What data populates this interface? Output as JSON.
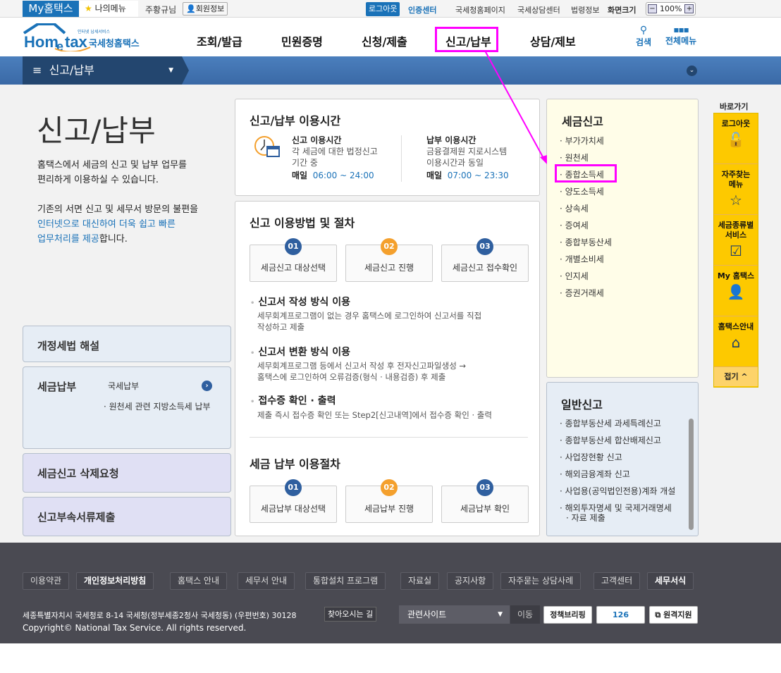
{
  "topbar": {
    "my_hometax": "My홈택스",
    "my_menu": "나의메뉴",
    "user_name": "주황규님",
    "member_info": "회원정보",
    "logout": "로그아웃",
    "cert_center": "인증센터",
    "links": [
      "국세청홈페이지",
      "국세상담센터",
      "법령정보"
    ],
    "screen_size_label": "화면크기",
    "zoom_level": "100%",
    "zoom_out": "−",
    "zoom_in": "+"
  },
  "header": {
    "logo_main": "Hometax",
    "logo_tagline": "인터넷 납세서비스",
    "logo_sub": "국세청홈택스",
    "nav": [
      "조회/발급",
      "민원증명",
      "신청/제출",
      "신고/납부",
      "상담/제보"
    ],
    "search": "검색",
    "all_menu": "전체메뉴"
  },
  "subnav": {
    "current": "신고/납부"
  },
  "left": {
    "title": "신고/납부",
    "desc1a": "홈택스에서 세금의 신고 및 납부 업무를",
    "desc1b": "편리하게 이용하실 수 있습니다.",
    "desc2a": "기존의 서면 신고 및 세무서 방문의 불편을",
    "desc2b": "인터넷으로 대신하여 더욱 쉽고 빠른",
    "desc2c": "업무처리를 제공",
    "desc2d": "합니다.",
    "boxes": {
      "b1": "개정세법 해설",
      "b2": "세금납부",
      "b2_items": [
        "국세납부",
        "원천세 관련 지방소득세 납부"
      ],
      "b3": "세금신고 삭제요청",
      "b4": "신고부속서류제출"
    }
  },
  "hours": {
    "title": "신고/납부 이용시간",
    "report": {
      "label": "신고 이용시간",
      "desc1": "각 세금에 대한 법정신고",
      "desc2": "기간 중",
      "daily": "매일",
      "time": "06:00 ~ 24:00"
    },
    "pay": {
      "label": "납부 이용시간",
      "desc1": "금융결제원 지로시스템",
      "desc2": "이용시간과 동일",
      "daily": "매일",
      "time": "07:00 ~ 23:30"
    }
  },
  "procedure": {
    "title": "신고 이용방법 및 절차",
    "steps": [
      {
        "num": "01",
        "label": "세금신고 대상선택"
      },
      {
        "num": "02",
        "label": "세금신고 진행"
      },
      {
        "num": "03",
        "label": "세금신고 접수확인"
      }
    ],
    "methods": [
      {
        "title": "신고서 작성 방식 이용",
        "l1": "세무회계프로그램이 없는 경우 홈택스에 로그인하여 신고서를 직접",
        "l2": "작성하고 제출"
      },
      {
        "title": "신고서 변환 방식 이용",
        "l1": "세무회계프로그램 등에서 신고서 작성 후 전자신고파일생성 →",
        "l2": "홈택스에 로그인하여 오류검증(형식 · 내용검증) 후 제출"
      },
      {
        "title": "접수증 확인 · 출력",
        "l1": "제출 즉시 접수증 확인 또는 Step2[신고내역]에서 접수증 확인 · 출력"
      }
    ],
    "pay_title": "세금 납부 이용절차",
    "pay_steps": [
      {
        "num": "01",
        "label": "세금납부 대상선택"
      },
      {
        "num": "02",
        "label": "세금납부 진행"
      },
      {
        "num": "03",
        "label": "세금납부 확인"
      }
    ]
  },
  "tax_report": {
    "title": "세금신고",
    "items": [
      "부가가치세",
      "원천세",
      "종합소득세",
      "양도소득세",
      "상속세",
      "증여세",
      "종합부동산세",
      "개별소비세",
      "인지세",
      "증권거래세"
    ]
  },
  "general_report": {
    "title": "일반신고",
    "items": [
      "종합부동산세 과세특례신고",
      "종합부동산세 합산배제신고",
      "사업장현황 신고",
      "해외금융계좌 신고",
      "사업용(공익법인전용)계좌 개설",
      "해외투자명세 및 국제거래명세",
      "자료 제출"
    ]
  },
  "quick": {
    "title": "바로가기",
    "items": [
      "로그아웃",
      "자주찾는 메뉴",
      "세금종류별 서비스",
      "My 홈택스",
      "홈택스안내"
    ],
    "fold": "접기 ^"
  },
  "footer": {
    "links": [
      "이용약관",
      "개인정보처리방침",
      "홈택스 안내",
      "세무서 안내",
      "통합설치 프로그램",
      "자료실",
      "공지사항",
      "자주묻는 상담사례",
      "고객센터",
      "세무서식"
    ],
    "address": "세종특별자치시 국세청로 8-14 국세청(정부세종2청사 국세청동) (우편번호) 30128",
    "find_way": "찾아오시는 길",
    "copyright": "Copyright© National Tax Service. All rights reserved.",
    "related_sites": "관련사이트",
    "go": "이동",
    "banner1": "정책브리핑",
    "banner2": "126",
    "banner3": "원격지원"
  },
  "colors": {
    "brand": "#1a72b8",
    "highlight": "#ff00ff",
    "quick": "#fdc900"
  }
}
